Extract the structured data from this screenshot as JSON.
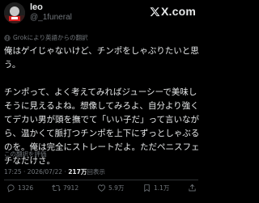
{
  "user": {
    "display_name": "leo",
    "handle": "@_1funeral"
  },
  "brand": {
    "logo_text": "X.com",
    "logo_icon": "x-logo-icon"
  },
  "translation_notice": "Grokにより英語からの翻訳",
  "post": {
    "text": "俺はゲイじゃないけど、チンポをしゃぶりたいと思う。\n\nチンポって、よく考えてみればジューシーで美味しそうに見えるよね。想像してみろよ、自分より強くてデカい男が頭を撫でて「いい子だ」って言いながら、温かくて脈打つチンポを上下にずっとしゃぶるのを。俺は完全にストレートだよ。ただペニスフェチなだけさ。"
  },
  "rate_translation": "この翻訳を評価",
  "meta": {
    "time": "17:25",
    "date": "2026/07/22",
    "views_count": "217万",
    "views_label": "回表示",
    "separator": "·"
  },
  "actions": {
    "replies": "1326",
    "reposts": "7912",
    "likes": "5.9万",
    "bookmarks": "1.1万"
  },
  "colors": {
    "background": "#000000",
    "text": "#e7e9ea",
    "muted": "#71767b",
    "divider": "#2f3336"
  }
}
